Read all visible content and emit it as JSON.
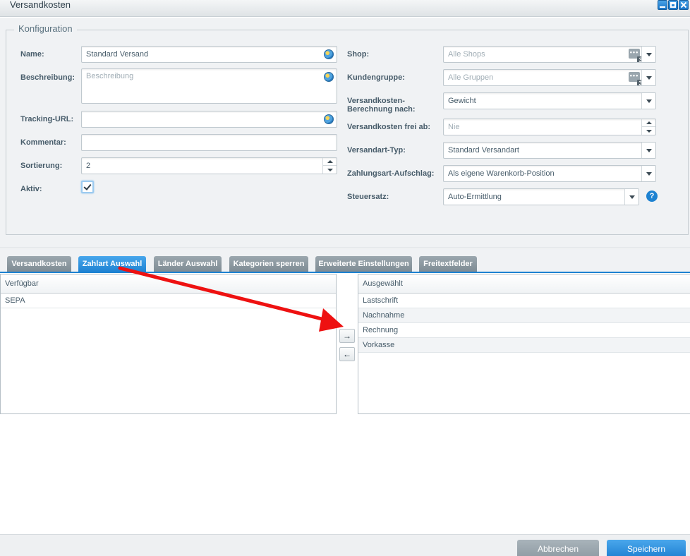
{
  "window": {
    "title": "Versandkosten"
  },
  "config": {
    "legend": "Konfiguration",
    "name_label": "Name:",
    "name_value": "Standard Versand",
    "description_label": "Beschreibung:",
    "description_placeholder": "Beschreibung",
    "tracking_label": "Tracking-URL:",
    "tracking_value": "",
    "comment_label": "Kommentar:",
    "comment_value": "",
    "sort_label": "Sortierung:",
    "sort_value": "2",
    "active_label": "Aktiv:",
    "active_checked": true,
    "shop_label": "Shop:",
    "shop_placeholder": "Alle Shops",
    "shop_selected_count": "3",
    "customergroup_label": "Kundengruppe:",
    "customergroup_placeholder": "Alle Gruppen",
    "customergroup_selected_count": "3",
    "calc_label_line1": "Versandkosten-",
    "calc_label_line2": "Berechnung nach:",
    "calc_value": "Gewicht",
    "free_label": "Versandkosten frei ab:",
    "free_placeholder": "Nie",
    "type_label": "Versandart-Typ:",
    "type_value": "Standard Versandart",
    "surcharge_label": "Zahlungsart-Aufschlag:",
    "surcharge_value": "Als eigene Warenkorb-Position",
    "tax_label": "Steuersatz:",
    "tax_value": "Auto-Ermittlung",
    "help_glyph": "?",
    "more_glyph": "•••"
  },
  "tabs": [
    {
      "label": "Versandkosten",
      "active": false
    },
    {
      "label": "Zahlart Auswahl",
      "active": true
    },
    {
      "label": "Länder Auswahl",
      "active": false
    },
    {
      "label": "Kategorien sperren",
      "active": false
    },
    {
      "label": "Erweiterte Einstellungen",
      "active": false
    },
    {
      "label": "Freitextfelder",
      "active": false
    }
  ],
  "available": {
    "header": "Verfügbar",
    "items": [
      "SEPA"
    ]
  },
  "selected": {
    "header": "Ausgewählt",
    "items": [
      "Lastschrift",
      "Nachnahme",
      "Rechnung",
      "Vorkasse"
    ]
  },
  "move_buttons": {
    "add": "→",
    "remove": "←"
  },
  "footer": {
    "cancel_label": "Abbrechen",
    "save_label": "Speichern"
  },
  "colors": {
    "accent": "#1d82d1",
    "annotation_arrow": "#ee1111"
  }
}
